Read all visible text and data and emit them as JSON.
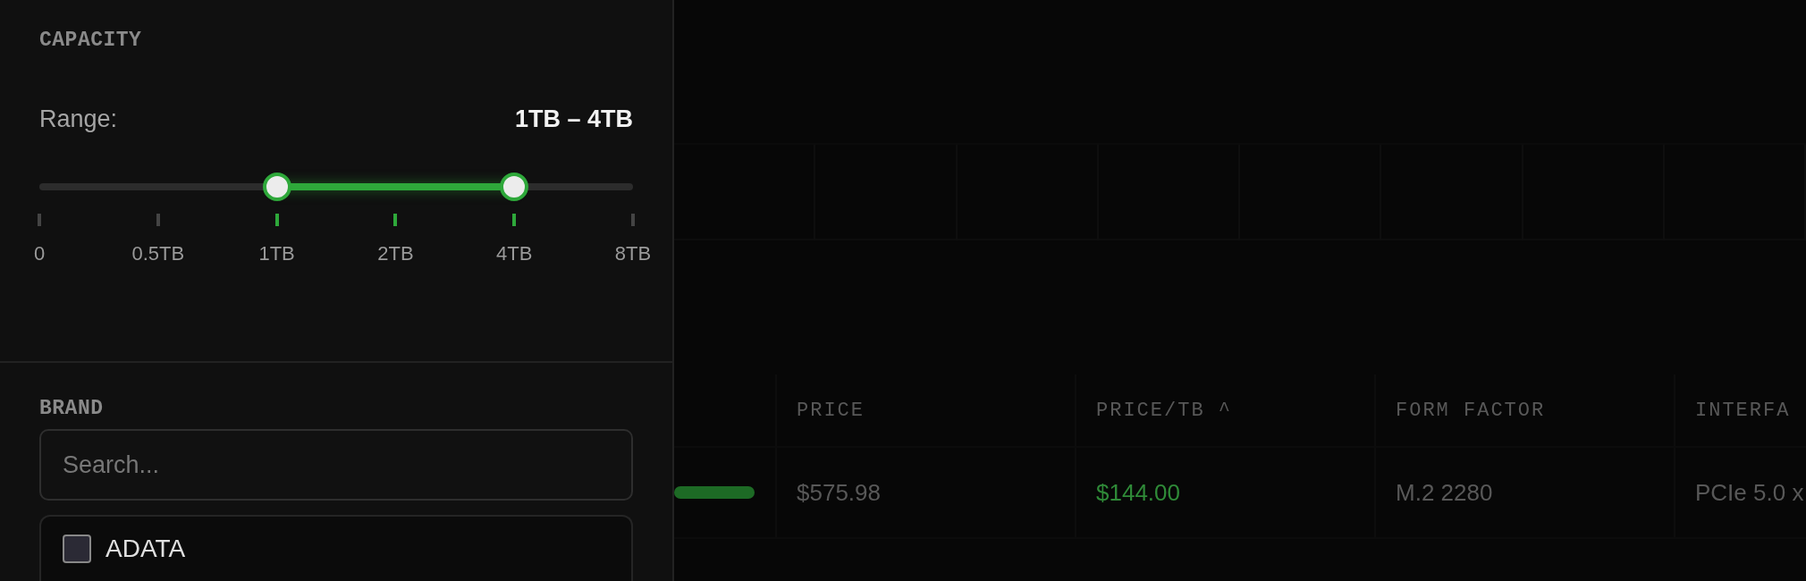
{
  "filters": {
    "capacity": {
      "title": "CAPACITY",
      "range_label": "Range:",
      "range_value": "1TB – 4TB",
      "thumbs": [
        {
          "level": 0.4
        },
        {
          "level": 0.8
        }
      ],
      "ticks": [
        {
          "label": "0",
          "in_range": false
        },
        {
          "label": "0.5TB",
          "in_range": false
        },
        {
          "label": "1TB",
          "in_range": true
        },
        {
          "label": "2TB",
          "in_range": true
        },
        {
          "label": "4TB",
          "in_range": true
        },
        {
          "label": "8TB",
          "in_range": false
        }
      ]
    },
    "brand": {
      "title": "BRAND",
      "search": {
        "placeholder": "Search..."
      },
      "items": [
        {
          "label": "ADATA",
          "checked": false
        }
      ]
    }
  },
  "table": {
    "columns": [
      "PRICE",
      "PRICE/TB ^",
      "FORM FACTOR",
      "INTERFA"
    ],
    "rows": [
      {
        "cells": [
          {
            "text": "$575.98",
            "highlight": false
          },
          {
            "text": "$144.00",
            "highlight": true
          },
          {
            "text": "M.2 2280",
            "highlight": false
          },
          {
            "text": "PCIe 5.0 x",
            "highlight": false
          }
        ]
      }
    ]
  }
}
